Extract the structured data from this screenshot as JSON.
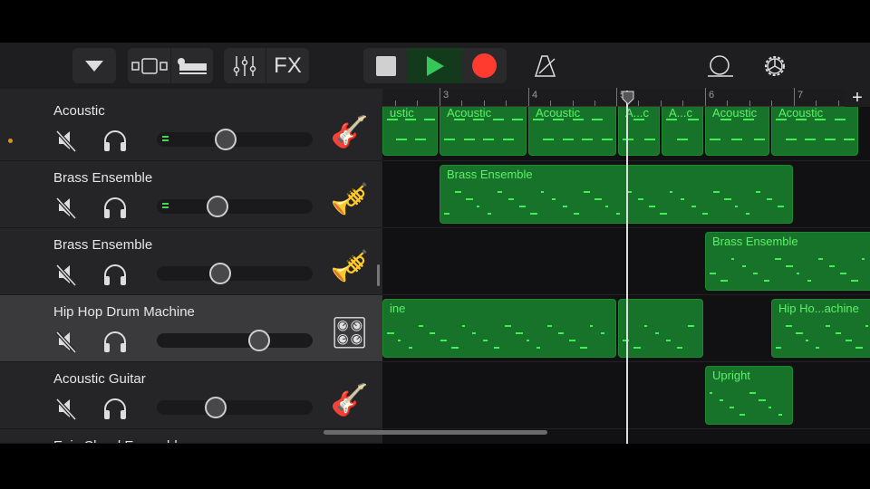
{
  "toolbar": {
    "browser": "dropdown",
    "view": "tracks-view",
    "smart": "smart-controls",
    "mixer": "mixer",
    "fx_label": "FX",
    "stop": "stop",
    "play": "play",
    "record": "record",
    "metronome": "metronome",
    "loop": "loop-browser",
    "settings": "settings"
  },
  "ruler": {
    "bars": [
      "3",
      "4",
      "5",
      "6",
      "7"
    ],
    "add_label": "+"
  },
  "tracks": [
    {
      "name": "Acoustic",
      "volume": 0.43,
      "instrument": "🎸",
      "regions": [
        {
          "label": "ustic"
        },
        {
          "label": "Acoustic"
        },
        {
          "label": "Acoustic"
        },
        {
          "label": "A...c"
        },
        {
          "label": "A...c"
        },
        {
          "label": "Acoustic"
        },
        {
          "label": "Acoustic"
        }
      ]
    },
    {
      "name": "Brass Ensemble",
      "volume": 0.37,
      "instrument": "🎺",
      "regions": [
        {
          "label": "Brass Ensemble"
        }
      ]
    },
    {
      "name": "Brass Ensemble",
      "volume": 0.39,
      "instrument": "🎺",
      "regions": [
        {
          "label": "Brass Ensemble"
        }
      ]
    },
    {
      "name": "Hip Hop Drum Machine",
      "volume": 0.68,
      "instrument": "🎛",
      "regions": [
        {
          "label": "ine"
        },
        {
          "label": ""
        },
        {
          "label": "Hip Ho...achine"
        }
      ]
    },
    {
      "name": "Acoustic Guitar",
      "volume": 0.36,
      "instrument": "🎸",
      "regions": [
        {
          "label": "Upright"
        }
      ]
    },
    {
      "name": "Epic Chord Ensemble"
    }
  ],
  "colors": {
    "region": "#17732a",
    "note": "#3ef050",
    "record": "#ff3b30",
    "play": "#34c759"
  }
}
